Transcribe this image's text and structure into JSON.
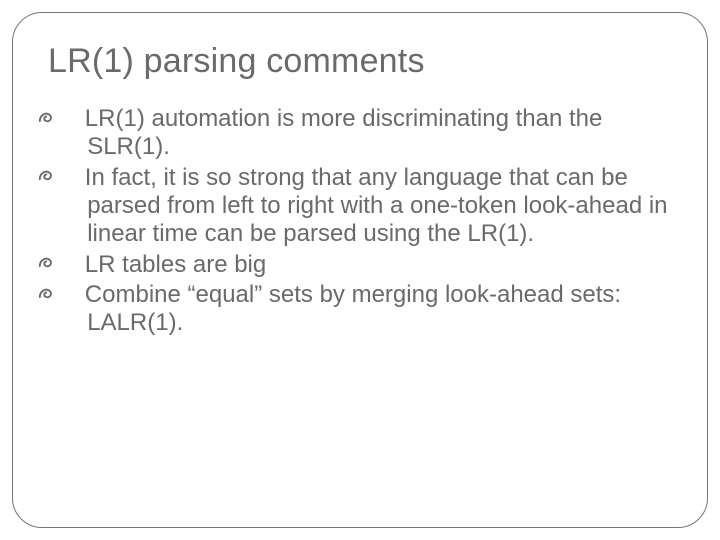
{
  "slide": {
    "title": "LR(1) parsing comments",
    "bullets": [
      "LR(1) automation is more discriminating than the SLR(1).",
      "In fact, it is so strong that any language that can be parsed from left to right with a one-token look-ahead in linear time can be parsed using the LR(1).",
      "LR tables are big",
      "Combine “equal” sets by merging look-ahead sets: LALR(1)."
    ]
  }
}
